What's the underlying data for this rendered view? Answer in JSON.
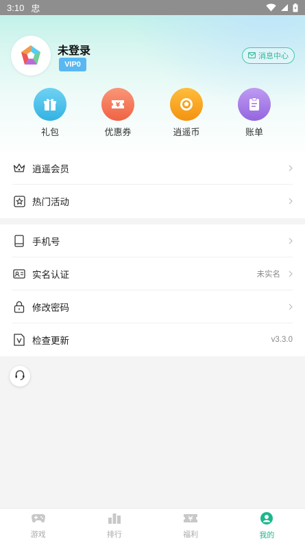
{
  "status_bar": {
    "time": "3:10",
    "notification_glyph": "忠",
    "icons": [
      "wifi-icon",
      "cell-signal-icon",
      "battery-icon"
    ]
  },
  "profile": {
    "username": "未登录",
    "vip_level": "VIP0",
    "message_center": "消息中心"
  },
  "quick_actions": [
    {
      "label": "礼包",
      "icon": "gift-icon",
      "color": "#4bbfe8"
    },
    {
      "label": "优惠券",
      "icon": "coupon-icon",
      "color": "#f5775a"
    },
    {
      "label": "逍遥币",
      "icon": "coin-icon",
      "color": "#f7a21b"
    },
    {
      "label": "账单",
      "icon": "bill-icon",
      "color": "#a77ce6"
    }
  ],
  "menu_group_1": [
    {
      "label": "逍遥会员",
      "icon": "crown-icon",
      "value": ""
    },
    {
      "label": "热门活动",
      "icon": "star-icon",
      "value": ""
    }
  ],
  "menu_group_2": [
    {
      "label": "手机号",
      "icon": "phone-icon",
      "value": ""
    },
    {
      "label": "实名认证",
      "icon": "id-card-icon",
      "value": "未实名"
    },
    {
      "label": "修改密码",
      "icon": "lock-icon",
      "value": ""
    },
    {
      "label": "检查更新",
      "icon": "update-icon",
      "value": "v3.3.0"
    }
  ],
  "bottom_nav": [
    {
      "label": "游戏",
      "icon": "gamepad-icon",
      "active": false
    },
    {
      "label": "排行",
      "icon": "ranking-icon",
      "active": false
    },
    {
      "label": "福利",
      "icon": "ticket-icon",
      "active": false
    },
    {
      "label": "我的",
      "icon": "profile-icon",
      "active": true
    }
  ],
  "colors": {
    "accent": "#1eb78e",
    "vip_badge": "#59b7f2",
    "message_border": "#48c6a9"
  }
}
